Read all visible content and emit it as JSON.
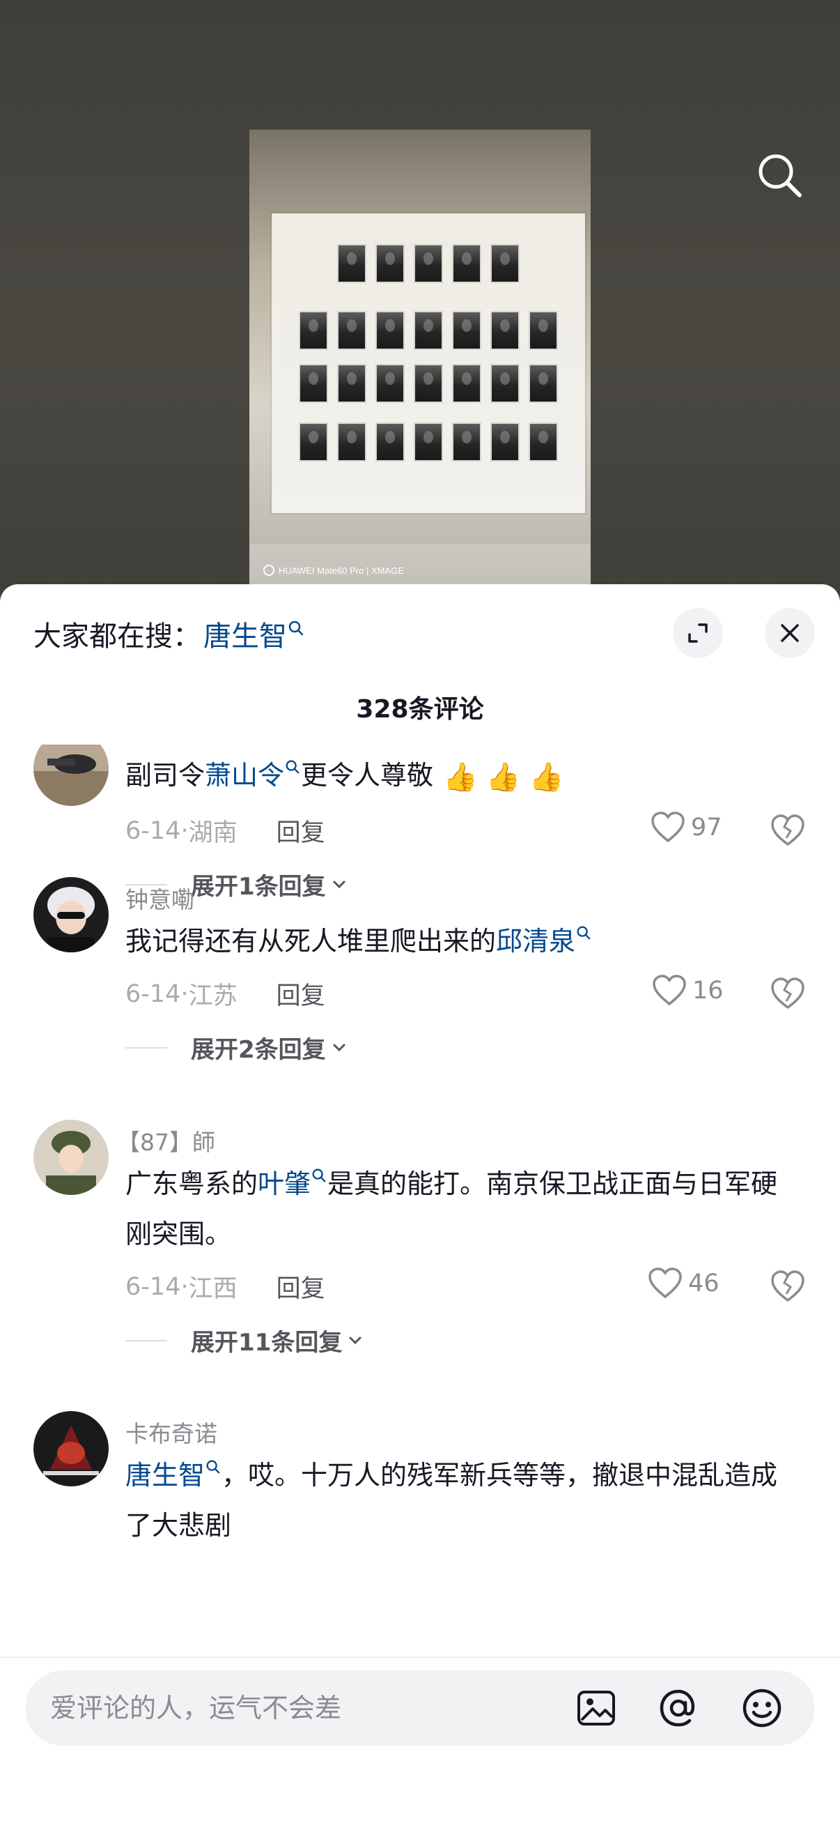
{
  "hot_search": {
    "prefix": "大家都在搜：",
    "keyword": "唐生智"
  },
  "comment_count": "328条评论",
  "photo": {
    "watermark": "HUAWEI Mate60 Pro | XMAGE"
  },
  "comments": [
    {
      "username": "",
      "text_before": "副司令",
      "link": "萧山令",
      "text_after": "更令人尊敬",
      "emojis": [
        "👍",
        "👍",
        "👍"
      ],
      "date": "6-14",
      "location": "湖南",
      "reply_label": "回复",
      "likes": "97",
      "expand": "展开1条回复"
    },
    {
      "username": "钟意嘞",
      "text_before": "我记得还有从死人堆里爬出来的",
      "link": "邱清泉",
      "text_after": "",
      "date": "6-14",
      "location": "江苏",
      "reply_label": "回复",
      "likes": "16",
      "expand": "展开2条回复"
    },
    {
      "username": "【87】師",
      "text_before": "广东粤系的",
      "link": "叶肇",
      "text_after": "是真的能打。南京保卫战正面与日军硬刚突围。",
      "date": "6-14",
      "location": "江西",
      "reply_label": "回复",
      "likes": "46",
      "expand": "展开11条回复"
    },
    {
      "username": "卡布奇诺",
      "text_before": "",
      "link": "唐生智",
      "text_after": "，哎。十万人的残军新兵等等，撤退中混乱造成了大悲剧"
    }
  ],
  "input": {
    "placeholder": "爱评论的人，运气不会差"
  },
  "colors": {
    "link": "#04498d",
    "text": "#161823",
    "muted": "#8a8b91",
    "sheet_bg": "#ffffff"
  }
}
